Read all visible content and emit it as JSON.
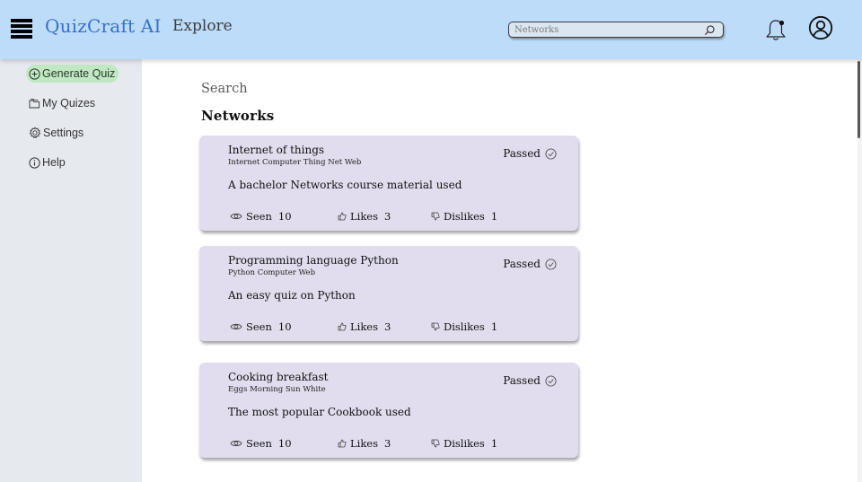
{
  "header": {
    "brand": "QuizCraft AI",
    "page_title": "Explore",
    "search_value": "Networks"
  },
  "sidebar": {
    "items": [
      {
        "label": "Generate Quiz",
        "icon": "plus-circle-icon",
        "active": true
      },
      {
        "label": "My Quizes",
        "icon": "folder-icon",
        "active": false
      },
      {
        "label": "Settings",
        "icon": "gear-icon",
        "active": false
      },
      {
        "label": "Help",
        "icon": "info-icon",
        "active": false
      }
    ]
  },
  "main": {
    "search_label": "Search",
    "section_title": "Networks",
    "stat_labels": {
      "seen": "Seen",
      "likes": "Likes",
      "dislikes": "Dislikes"
    },
    "cards": [
      {
        "title": "Internet of things",
        "tags": "Internet Computer Thing Net Web",
        "description": "A bachelor Networks course material used",
        "status": "Passed",
        "seen": "10",
        "likes": "3",
        "dislikes": "1"
      },
      {
        "title": "Programming language Python",
        "tags": "Python Computer Web",
        "description": "An easy quiz on Python",
        "status": "Passed",
        "seen": "10",
        "likes": "3",
        "dislikes": "1"
      },
      {
        "title": "Cooking breakfast",
        "tags": "Eggs Morning Sun White",
        "description": "The most popular Cookbook used",
        "status": "Passed",
        "seen": "10",
        "likes": "3",
        "dislikes": "1"
      }
    ]
  },
  "colors": {
    "header_bg": "#bcdcfa",
    "brand": "#3a6fc9",
    "sidebar_bg": "#e6e9ee",
    "active_item_bg": "#bfe8c3",
    "card_bg": "#e1ddee"
  }
}
